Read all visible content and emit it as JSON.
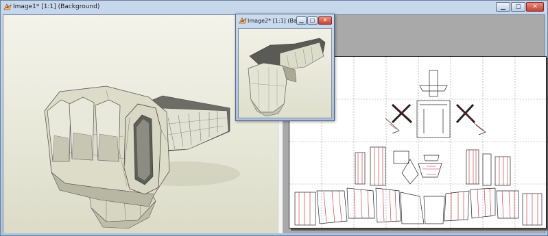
{
  "main_window": {
    "title": "Image1* [1:1] (Background)",
    "minimize_glyph": "▁",
    "maximize_glyph": "▢",
    "close_glyph": "✕"
  },
  "sub_window": {
    "title": "Image2* [1:1] (Backgr...",
    "minimize_glyph": "▁",
    "maximize_glyph": "▢",
    "close_glyph": "✕"
  },
  "icons": {
    "app_icon": "pepakura-app-icon"
  },
  "colors": {
    "model_surface": "#d9d9c6",
    "model_edge": "#555555",
    "fold_line": "#d0202a",
    "close_button": "#c8432f"
  }
}
